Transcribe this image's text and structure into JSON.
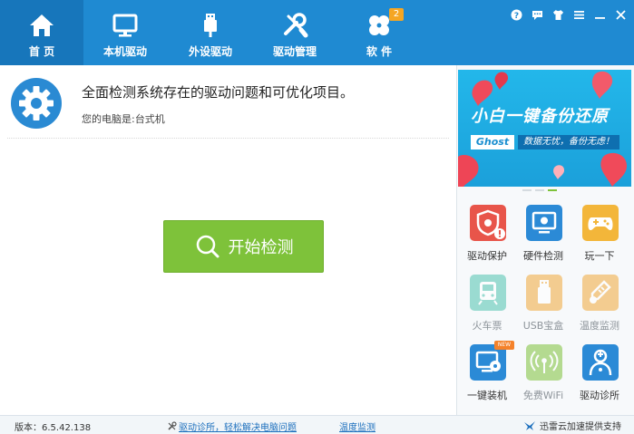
{
  "nav": {
    "tabs": [
      {
        "label": "首 页",
        "icon": "home-icon",
        "active": true
      },
      {
        "label": "本机驱动",
        "icon": "monitor-icon",
        "active": false
      },
      {
        "label": "外设驱动",
        "icon": "usb-icon",
        "active": false
      },
      {
        "label": "驱动管理",
        "icon": "tools-icon",
        "active": false
      },
      {
        "label": "软 件",
        "icon": "apps-icon",
        "active": false,
        "badge": "2"
      }
    ]
  },
  "window_controls": [
    "help-icon",
    "chat-icon",
    "shirt-icon",
    "menu-icon",
    "minimize-icon",
    "close-icon"
  ],
  "main": {
    "headline": "全面检测系统存在的驱动问题和可优化项目。",
    "pc_type": "您的电脑是:台式机",
    "scan_button": "开始检测"
  },
  "banner": {
    "title": "小白一键备份还原",
    "brand": "Ghost",
    "subtitle": "数据无忧，备份无虑！"
  },
  "tools": [
    {
      "label": "驱动保护",
      "icon": "shield-alert-icon",
      "color": "#e8554a",
      "enabled": true
    },
    {
      "label": "硬件检测",
      "icon": "hardware-monitor-icon",
      "color": "#2b8ad6",
      "enabled": true
    },
    {
      "label": "玩一下",
      "icon": "gamepad-icon",
      "color": "#f3b63a",
      "enabled": true
    },
    {
      "label": "火车票",
      "icon": "train-icon",
      "color": "#4fc3b0",
      "enabled": false
    },
    {
      "label": "USB宝盒",
      "icon": "usb-box-icon",
      "color": "#f0a93a",
      "enabled": false
    },
    {
      "label": "温度监测",
      "icon": "thermometer-icon",
      "color": "#f0a93a",
      "enabled": false
    },
    {
      "label": "一键装机",
      "icon": "install-system-icon",
      "color": "#2b8ad6",
      "enabled": true,
      "tag": "NEW"
    },
    {
      "label": "免费WiFi",
      "icon": "wifi-icon",
      "color": "#7ec23a",
      "enabled": false
    },
    {
      "label": "驱动诊所",
      "icon": "doctor-icon",
      "color": "#2b8ad6",
      "enabled": true
    }
  ],
  "footer": {
    "version": "版本：6.5.42.138",
    "clinic_link": "驱动诊所，轻松解决电脑问题",
    "temp_link": "温度监测",
    "sponsor": "迅雷云加速提供支持"
  },
  "colors": {
    "header": "#1f8ad2",
    "active_tab": "#1776bb",
    "scan_button": "#7ec23a",
    "banner": "#1ba0da"
  }
}
